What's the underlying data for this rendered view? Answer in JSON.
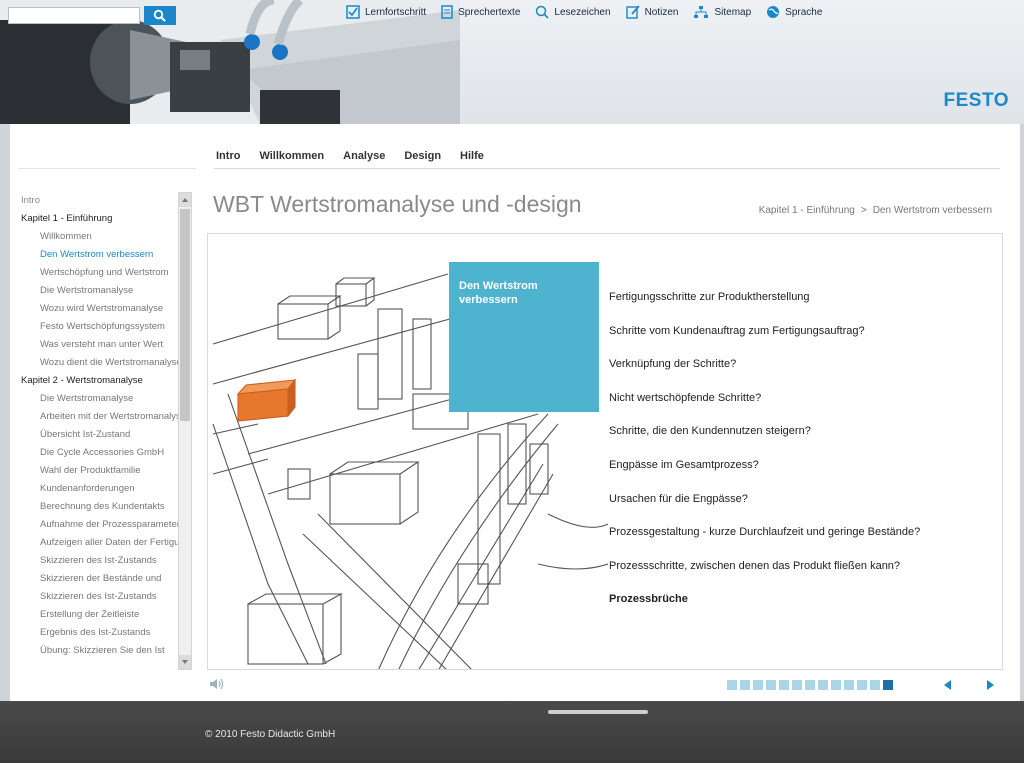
{
  "search": {
    "placeholder": ""
  },
  "toolbar": [
    {
      "label": "Lernfortschritt",
      "icon": "progress-icon"
    },
    {
      "label": "Sprechertexte",
      "icon": "document-icon"
    },
    {
      "label": "Lesezeichen",
      "icon": "bookmark-icon"
    },
    {
      "label": "Notizen",
      "icon": "pencil-icon"
    },
    {
      "label": "Sitemap",
      "icon": "sitemap-icon"
    },
    {
      "label": "Sprache",
      "icon": "globe-icon"
    }
  ],
  "logo": "FESTO",
  "nav": [
    "Intro",
    "Willkommen",
    "Analyse",
    "Design",
    "Hilfe"
  ],
  "sidebar": [
    {
      "label": "Intro",
      "type": "lvl0"
    },
    {
      "label": "Kapitel 1 - Einführung",
      "type": "chapter"
    },
    {
      "label": "Willkommen",
      "type": "lvl1"
    },
    {
      "label": "Den Wertstrom verbessern",
      "type": "lvl1",
      "active": true
    },
    {
      "label": "Wertschöpfung und Wertstrom",
      "type": "lvl1"
    },
    {
      "label": "Die Wertstromanalyse",
      "type": "lvl1"
    },
    {
      "label": "Wozu wird Wertstromanalyse",
      "type": "lvl1"
    },
    {
      "label": "Festo Wertschöpfungssystem",
      "type": "lvl1"
    },
    {
      "label": "Was versteht man unter Wert",
      "type": "lvl1"
    },
    {
      "label": "Wozu dient die Wertstromanalyse",
      "type": "lvl1"
    },
    {
      "label": "Kapitel 2 - Wertstromanalyse",
      "type": "chapter"
    },
    {
      "label": "Die Wertstromanalyse",
      "type": "lvl1"
    },
    {
      "label": "Arbeiten mit der Wertstromanalyse",
      "type": "lvl1"
    },
    {
      "label": "Übersicht Ist-Zustand",
      "type": "lvl1"
    },
    {
      "label": "Die Cycle Accessories GmbH",
      "type": "lvl1"
    },
    {
      "label": "Wahl der Produktfamilie",
      "type": "lvl1"
    },
    {
      "label": "Kundenanforderungen",
      "type": "lvl1"
    },
    {
      "label": "Berechnung des Kundentakts",
      "type": "lvl1"
    },
    {
      "label": "Aufnahme der Prozessparameter",
      "type": "lvl1"
    },
    {
      "label": "Aufzeigen aller Daten der Fertigung",
      "type": "lvl1"
    },
    {
      "label": "Skizzieren des Ist-Zustands",
      "type": "lvl1"
    },
    {
      "label": "Skizzieren der Bestände und",
      "type": "lvl1"
    },
    {
      "label": "Skizzieren des Ist-Zustands",
      "type": "lvl1"
    },
    {
      "label": "Erstellung der Zeitleiste",
      "type": "lvl1"
    },
    {
      "label": "Ergebnis des Ist-Zustands",
      "type": "lvl1"
    },
    {
      "label": "Übung: Skizzieren Sie den Ist",
      "type": "lvl1"
    }
  ],
  "page": {
    "title": "WBT Wertstromanalyse und -design",
    "breadcrumb": [
      "Kapitel 1 - Einführung",
      "Den Wertstrom verbessern"
    ],
    "breadcrumb_sep": ">"
  },
  "teal_box": {
    "title": "Den Wertstrom verbessern",
    "color": "#4db3cf"
  },
  "questions": [
    "Fertigungsschritte zur Produktherstellung",
    "Schritte vom Kundenauftrag zum Fertigungsauftrag?",
    "Verknüpfung der Schritte?",
    "Nicht wertschöpfende Schritte?",
    "Schritte, die den Kundennutzen steigern?",
    "Engpässe im Gesamtprozess?",
    "Ursachen für die Engpässe?",
    "Prozessgestaltung - kurze Durchlaufzeit und geringe Bestände?",
    "Prozessschritte, zwischen denen das Produkt fließen kann?",
    "Prozessbrüche"
  ],
  "progress": {
    "total": 13,
    "current": 13
  },
  "footer": {
    "copyright": "© 2010 Festo Didactic GmbH"
  },
  "colors": {
    "accent": "#1a88c9",
    "highlight": "#e8772e",
    "footer_bg": "#3f3f3f"
  }
}
